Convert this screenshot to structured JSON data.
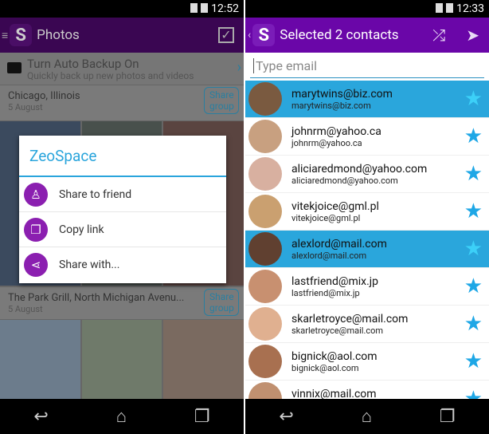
{
  "left": {
    "status": {
      "time": "12:52"
    },
    "action_bar": {
      "title": "Photos",
      "menu_icon": "hamburger-icon",
      "logo_icon": "zeospace-logo",
      "check_icon": "checkbox-icon"
    },
    "backup": {
      "title": "Turn Auto Backup On",
      "subtitle": "Quickly back up new photos and videos",
      "icon": "camera-icon"
    },
    "groups": [
      {
        "place": "Chicago, Illinois",
        "date": "5 August",
        "share_label": "Share group"
      },
      {
        "place": "The Park Grill, North Michigan Avenu...",
        "date": "5 August",
        "share_label": "Share group"
      }
    ],
    "dialog": {
      "title": "ZeoSpace",
      "items": [
        {
          "label": "Share to friend",
          "icon": "person-icon"
        },
        {
          "label": "Copy link",
          "icon": "copy-link-icon"
        },
        {
          "label": "Share with...",
          "icon": "share-icon"
        }
      ]
    }
  },
  "right": {
    "status": {
      "time": "12:33"
    },
    "action_bar": {
      "title": "Selected 2 contacts",
      "shuffle_icon": "shuffle-icon",
      "send_icon": "send-icon"
    },
    "search": {
      "placeholder": "Type email"
    },
    "contacts": [
      {
        "name": "marytwins@biz.com",
        "email": "marytwins@biz.com",
        "selected": true
      },
      {
        "name": "johnrm@yahoo.ca",
        "email": "johnrm@yahoo.ca",
        "selected": false
      },
      {
        "name": "aliciaredmond@yahoo.com",
        "email": "aliciaredmond@yahoo.com",
        "selected": false
      },
      {
        "name": "vitekjoice@gml.pl",
        "email": "vitekjoice@gml.pl",
        "selected": false
      },
      {
        "name": "alexlord@mail.com",
        "email": "alexlord@mail.com",
        "selected": true
      },
      {
        "name": "lastfriend@mix.jp",
        "email": "lastfriend@mix.jp",
        "selected": false
      },
      {
        "name": "skarletroyce@mail.com",
        "email": "skarletroyce@mail.com",
        "selected": false
      },
      {
        "name": "bignick@aol.com",
        "email": "bignick@aol.com",
        "selected": false
      },
      {
        "name": "vinnix@mail.com",
        "email": "vinnix@mail.com",
        "selected": false
      }
    ]
  },
  "colors": {
    "purple": "#6a06a8",
    "selected_row": "#2aa6dc",
    "accent": "#2aa5dc"
  }
}
